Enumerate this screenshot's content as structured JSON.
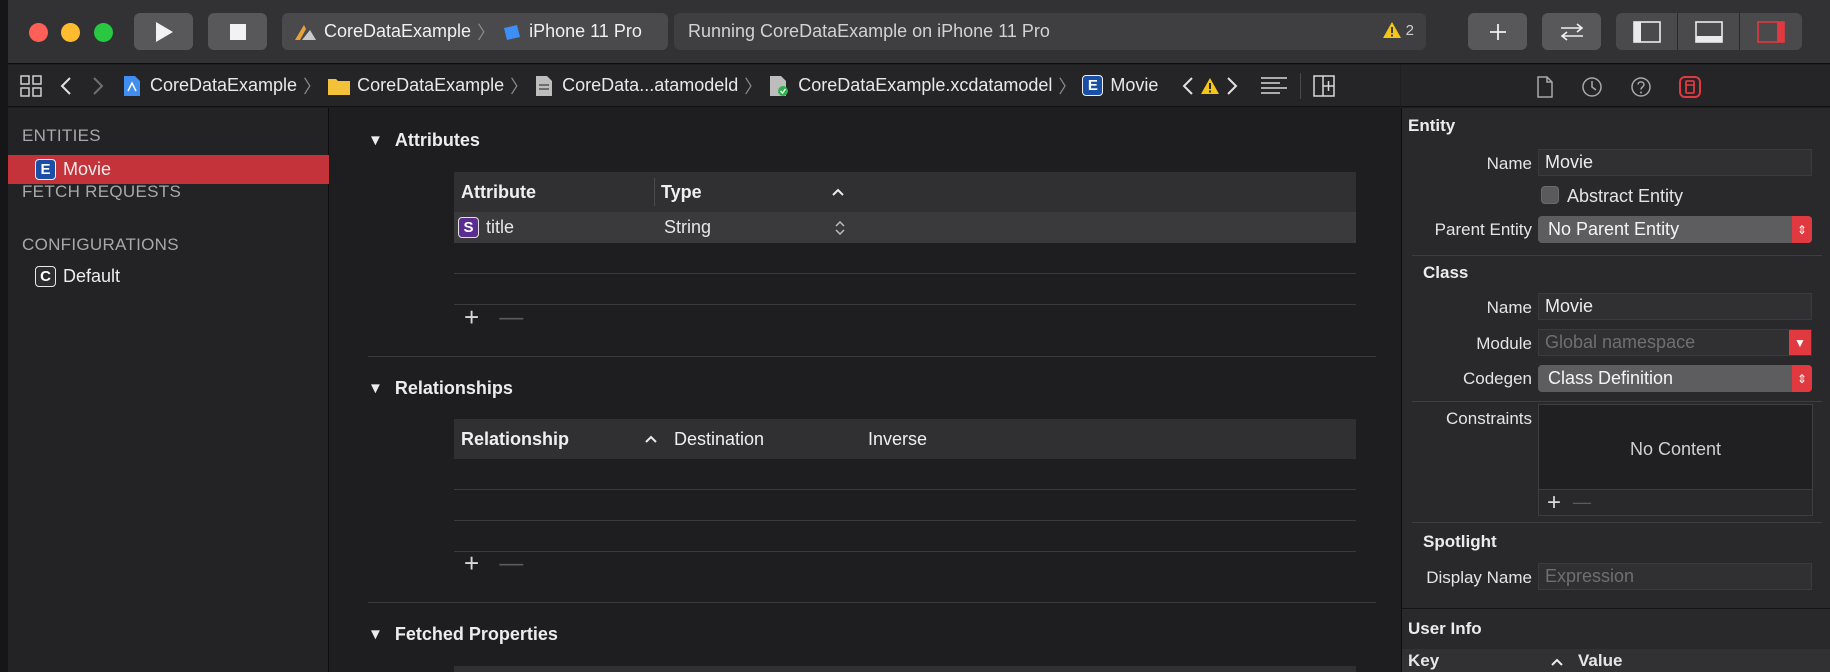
{
  "toolbar": {
    "scheme_name": "CoreDataExample",
    "device_name": "iPhone 11 Pro",
    "activity_text": "Running CoreDataExample on iPhone 11 Pro",
    "warning_count": "2"
  },
  "jumpbar": {
    "crumbs": [
      "CoreDataExample",
      "CoreDataExample",
      "CoreData...atamodeld",
      "CoreDataExample.xcdatamodel",
      "Movie"
    ]
  },
  "navigator": {
    "entities_header": "ENTITIES",
    "entity_items": [
      "Movie"
    ],
    "fetch_requests_header": "FETCH REQUESTS",
    "configurations_header": "CONFIGURATIONS",
    "configuration_items": [
      "Default"
    ],
    "entity_badge": "E",
    "configuration_badge": "C"
  },
  "attributes": {
    "title": "Attributes",
    "col_attribute": "Attribute",
    "col_type": "Type",
    "rows": [
      {
        "badge": "S",
        "name": "title",
        "type": "String"
      }
    ]
  },
  "relationships": {
    "title": "Relationships",
    "col_relationship": "Relationship",
    "col_destination": "Destination",
    "col_inverse": "Inverse"
  },
  "fetched_properties": {
    "title": "Fetched Properties"
  },
  "inspector": {
    "entity_header": "Entity",
    "name_label": "Name",
    "entity_name": "Movie",
    "abstract_label": "Abstract Entity",
    "parent_label": "Parent Entity",
    "parent_value": "No Parent Entity",
    "class_header": "Class",
    "class_name_label": "Name",
    "class_name": "Movie",
    "module_label": "Module",
    "module_placeholder": "Global namespace",
    "codegen_label": "Codegen",
    "codegen_value": "Class Definition",
    "constraints_label": "Constraints",
    "constraints_empty": "No Content",
    "spotlight_header": "Spotlight",
    "display_name_label": "Display Name",
    "display_name_placeholder": "Expression",
    "user_info_header": "User Info",
    "col_key": "Key",
    "col_value": "Value"
  },
  "colors": {
    "accent_red": "#c5333a",
    "warning_yellow": "#f5c518"
  }
}
